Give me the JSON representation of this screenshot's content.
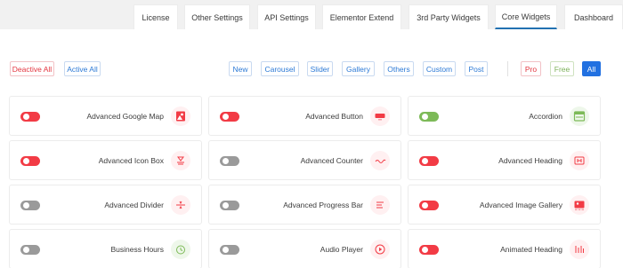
{
  "tabs": [
    {
      "label": "License"
    },
    {
      "label": "Other Settings"
    },
    {
      "label": "API Settings"
    },
    {
      "label": "Elementor Extend"
    },
    {
      "label": "3rd Party Widgets"
    },
    {
      "label": "Core Widgets",
      "active": true
    },
    {
      "label": "Dashboard"
    }
  ],
  "actions": {
    "deactive_all": "Deactive All",
    "active_all": "Active All"
  },
  "filters": [
    "New",
    "Carousel",
    "Slider",
    "Gallery",
    "Others",
    "Custom",
    "Post"
  ],
  "plan_filters": {
    "pro": "Pro",
    "free": "Free",
    "all": "All"
  },
  "colors": {
    "accent": "#2271e1",
    "toggle_on": "#f23b45",
    "toggle_off": "#9a9a9a",
    "toggle_green": "#7dba58",
    "icon_red": "#f23b45"
  },
  "widgets": [
    {
      "label": "Advanced Google Map",
      "state": "on",
      "icon": "map-icon"
    },
    {
      "label": "Advanced Button",
      "state": "on",
      "icon": "button-icon"
    },
    {
      "label": "Accordion",
      "state": "green",
      "icon": "accordion-icon"
    },
    {
      "label": "Advanced Icon Box",
      "state": "on",
      "icon": "icon-box-icon"
    },
    {
      "label": "Advanced Counter",
      "state": "off",
      "icon": "counter-icon"
    },
    {
      "label": "Advanced Heading",
      "state": "on",
      "icon": "heading-icon"
    },
    {
      "label": "Advanced Divider",
      "state": "off",
      "icon": "divider-icon"
    },
    {
      "label": "Advanced Progress Bar",
      "state": "off",
      "icon": "progress-bar-icon"
    },
    {
      "label": "Advanced Image Gallery",
      "state": "on",
      "icon": "image-gallery-icon"
    },
    {
      "label": "Business Hours",
      "state": "off",
      "icon": "clock-icon"
    },
    {
      "label": "Audio Player",
      "state": "off",
      "icon": "audio-play-icon"
    },
    {
      "label": "Animated Heading",
      "state": "on",
      "icon": "animated-heading-icon"
    }
  ]
}
